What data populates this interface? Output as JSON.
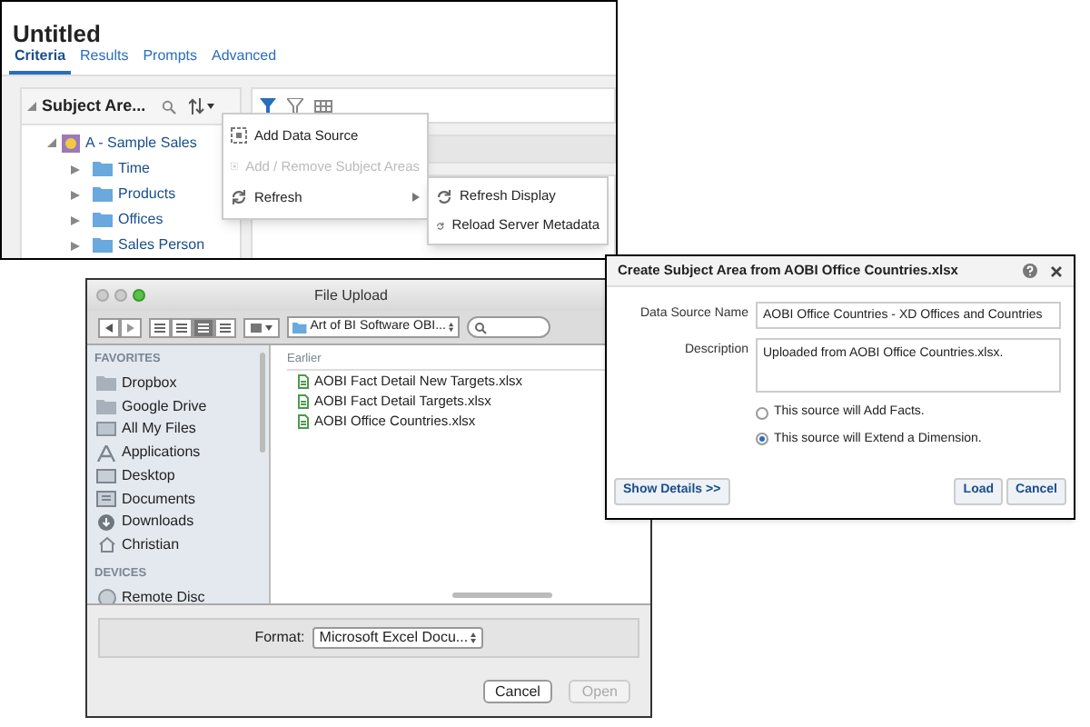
{
  "analysis_window": {
    "title": "Untitled",
    "tabs": [
      {
        "label": "Criteria",
        "selected": true
      },
      {
        "label": "Results",
        "selected": false
      },
      {
        "label": "Prompts",
        "selected": false
      },
      {
        "label": "Advanced",
        "selected": false
      }
    ],
    "panel": {
      "title": "Subject Are...",
      "tree": [
        {
          "label": "A - Sample Sales",
          "expanded": true,
          "children": [
            {
              "label": "Time",
              "expanded": false
            },
            {
              "label": "Products",
              "expanded": false
            },
            {
              "label": "Offices",
              "expanded": false
            },
            {
              "label": "Sales Person",
              "expanded": false
            }
          ]
        }
      ]
    },
    "context_menu": [
      {
        "label": "Add Data Source",
        "kind": "action",
        "disabled": false
      },
      {
        "label": "Add / Remove Subject Areas",
        "kind": "action",
        "disabled": true
      },
      {
        "label": "Refresh",
        "kind": "submenu",
        "disabled": false
      }
    ],
    "submenu": [
      {
        "label": "Refresh Display"
      },
      {
        "label": "Reload Server Metadata"
      }
    ]
  },
  "file_upload": {
    "title": "File Upload",
    "view_modes": [
      {
        "selected": false
      },
      {
        "selected": false
      },
      {
        "selected": true
      },
      {
        "selected": false
      }
    ],
    "location": "Art of BI Software OBI...",
    "sidebar": [
      {
        "heading": "FAVORITES",
        "items": [
          {
            "label": "Dropbox",
            "kind": "folder"
          },
          {
            "label": "Google Drive",
            "kind": "folder"
          },
          {
            "label": "All My Files",
            "kind": "files"
          },
          {
            "label": "Applications",
            "kind": "apps"
          },
          {
            "label": "Desktop",
            "kind": "desktop"
          },
          {
            "label": "Documents",
            "kind": "documents"
          },
          {
            "label": "Downloads",
            "kind": "downloads"
          },
          {
            "label": "Christian",
            "kind": "home"
          }
        ]
      },
      {
        "heading": "DEVICES",
        "items": [
          {
            "label": "Remote Disc",
            "kind": "disc"
          }
        ]
      }
    ],
    "list_heading": "Earlier",
    "files": [
      "AOBI Fact Detail New Targets.xlsx",
      "AOBI Fact Detail Targets.xlsx",
      "AOBI Office Countries.xlsx"
    ],
    "format_label": "Format:",
    "format": "Microsoft Excel Docu...",
    "buttons": [
      {
        "label": "Cancel",
        "disabled": false
      },
      {
        "label": "Open",
        "disabled": true
      }
    ]
  },
  "dialog": {
    "title": "Create Subject Area from AOBI Office Countries.xlsx",
    "name_label": "Data Source Name",
    "name_value": "AOBI Office Countries - XD Offices and Countries",
    "description_label": "Description",
    "description_value": "Uploaded from AOBI Office Countries.xlsx.",
    "options": [
      {
        "label": "This source will Add Facts.",
        "selected": false
      },
      {
        "label": "This source will Extend a Dimension.",
        "selected": true
      }
    ],
    "details_button": "Show Details >>",
    "buttons": [
      "Load",
      "Cancel"
    ]
  }
}
